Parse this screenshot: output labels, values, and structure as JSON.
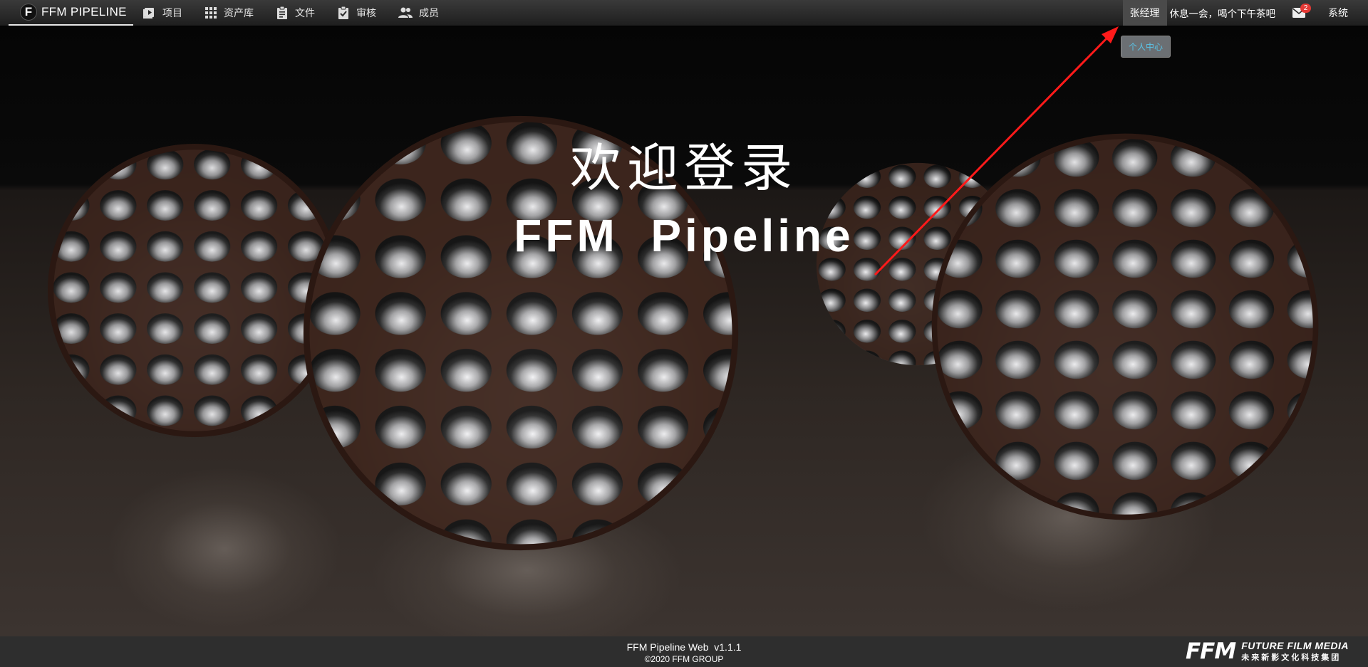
{
  "brand": {
    "logo_letter": "F",
    "name": "FFM PIPELINE"
  },
  "nav": [
    {
      "label": "项目",
      "icon": "project-icon"
    },
    {
      "label": "资产库",
      "icon": "asset-library-icon"
    },
    {
      "label": "文件",
      "icon": "file-icon"
    },
    {
      "label": "审核",
      "icon": "review-icon"
    },
    {
      "label": "成员",
      "icon": "members-icon"
    }
  ],
  "user": {
    "name": "张经理",
    "greeting": "休息一会，喝个下午茶吧",
    "mail_count": "2",
    "mail_icon": "mail-icon",
    "system_label": "系统"
  },
  "dropdown": {
    "personal_center": "个人中心"
  },
  "hero": {
    "welcome": "欢迎登录",
    "app_name": "FFM  Pipeline"
  },
  "footer": {
    "version": "FFM Pipeline Web  v1.1.1",
    "copyright": "©2020 FFM GROUP",
    "logo_mark": "FFM",
    "logo_en": "FUTURE FILM MEDIA",
    "logo_cn": "未来新影文化科技集团"
  },
  "colors": {
    "topbar": "#2c2c2c",
    "footer": "#2e2e2e",
    "dropdown_text": "#5bc3e6",
    "badge": "#e53935",
    "arrow": "#ff1a1a"
  }
}
